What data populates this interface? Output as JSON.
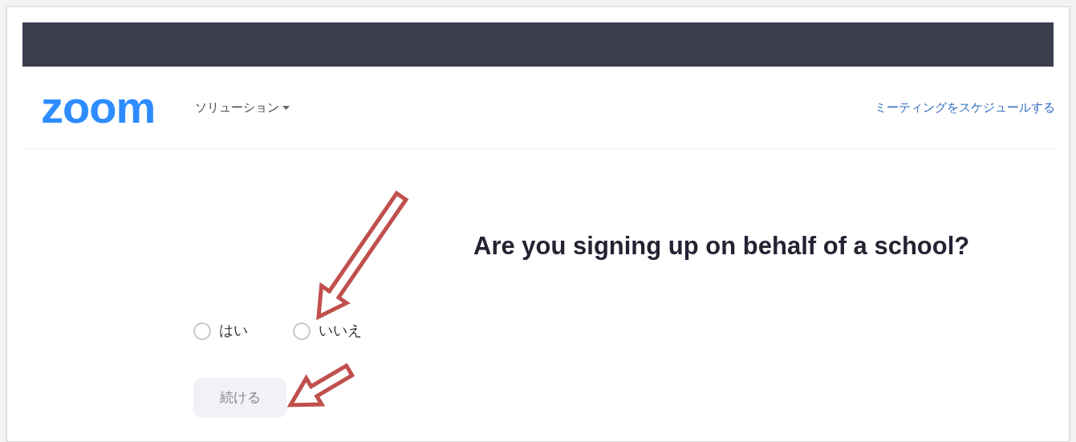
{
  "header": {
    "logo": "zoom",
    "nav": {
      "label": "ソリューション"
    },
    "schedule_link": "ミーティングをスケジュールする"
  },
  "question": "Are you signing up on behalf of a school?",
  "options": [
    {
      "label": "はい",
      "selected": false
    },
    {
      "label": "いいえ",
      "selected": false
    }
  ],
  "continue_button": {
    "label": "続ける",
    "disabled": true
  }
}
